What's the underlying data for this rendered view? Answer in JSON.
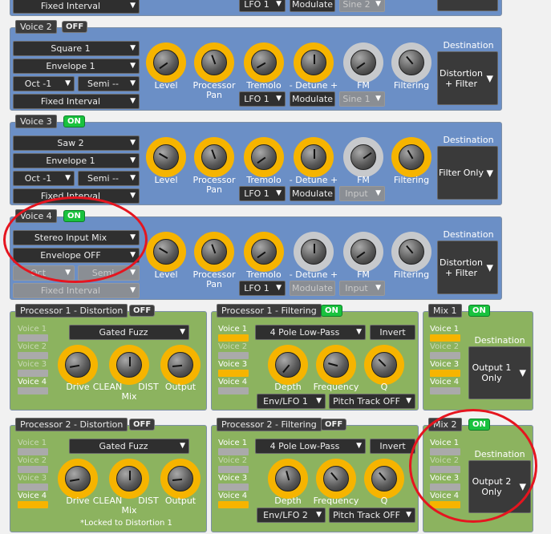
{
  "voice1": {
    "interval": "Fixed Interval",
    "lfo": "LFO 1",
    "mod": "Modulate",
    "wave2": "Sine 2"
  },
  "voice2": {
    "title": "Voice 2",
    "state": "OFF",
    "osc": "Square 1",
    "env": "Envelope 1",
    "oct": "Oct -1",
    "semi": "Semi --",
    "interval": "Fixed Interval",
    "lfo": "LFO 1",
    "mod": "Modulate",
    "wave2": "Sine 1",
    "dest_title": "Destination",
    "dest": "Distortion + Filter"
  },
  "voice3": {
    "title": "Voice 3",
    "state": "ON",
    "osc": "Saw 2",
    "env": "Envelope 1",
    "oct": "Oct -1",
    "semi": "Semi --",
    "interval": "Fixed Interval",
    "lfo": "LFO 1",
    "mod": "Modulate",
    "wave2": "Input",
    "dest_title": "Destination",
    "dest": "Filter Only"
  },
  "voice4": {
    "title": "Voice 4",
    "state": "ON",
    "osc": "Stereo Input Mix",
    "env": "Envelope OFF",
    "oct": "Oct",
    "semi": "Semi",
    "interval": "Fixed Interval",
    "lfo": "LFO 1",
    "mod": "Modulate",
    "wave2": "Input",
    "dest_title": "Destination",
    "dest": "Distortion + Filter"
  },
  "knob_labels": {
    "level": "Level",
    "pan": "Processor Pan",
    "tremolo": "Tremolo",
    "detune": "- Detune +",
    "fm": "FM",
    "filtering": "Filtering"
  },
  "voices": {
    "v1": "Voice 1",
    "v2": "Voice 2",
    "v3": "Voice 3",
    "v4": "Voice 4"
  },
  "proc1_dist": {
    "title": "Processor 1 - Distortion",
    "state": "OFF",
    "type": "Gated Fuzz",
    "drive": "Drive",
    "mix_clean": "CLEAN",
    "mix_dist": "DIST",
    "mix": "Mix",
    "output": "Output"
  },
  "proc1_filt": {
    "title": "Processor 1 - Filtering",
    "state": "ON",
    "type": "4 Pole Low-Pass",
    "invert": "Invert",
    "depth": "Depth",
    "frequency": "Frequency",
    "q": "Q",
    "env": "Env/LFO 1",
    "pitch": "Pitch Track OFF"
  },
  "mix1": {
    "title": "Mix 1",
    "state": "ON",
    "dest_title": "Destination",
    "dest": "Output 1 Only"
  },
  "proc2_dist": {
    "title": "Processor 2 - Distortion",
    "state": "OFF",
    "type": "Gated Fuzz",
    "drive": "Drive",
    "mix_clean": "CLEAN",
    "mix_dist": "DIST",
    "mix": "Mix",
    "output": "Output",
    "note": "*Locked to Distortion 1"
  },
  "proc2_filt": {
    "title": "Processor 2 - Filtering",
    "state": "OFF",
    "type": "4 Pole Low-Pass",
    "invert": "Invert",
    "depth": "Depth",
    "frequency": "Frequency",
    "q": "Q",
    "env": "Env/LFO 2",
    "pitch": "Pitch Track OFF"
  },
  "mix2": {
    "title": "Mix 2",
    "state": "ON",
    "dest_title": "Destination",
    "dest": "Output 2 Only"
  },
  "colors": {
    "voice_panel": "#6b8fc6",
    "processor_panel": "#8cb35f",
    "knob_active": "#f6b400",
    "toggle_on": "#19c23e",
    "annotation_ring": "#e5151f"
  }
}
